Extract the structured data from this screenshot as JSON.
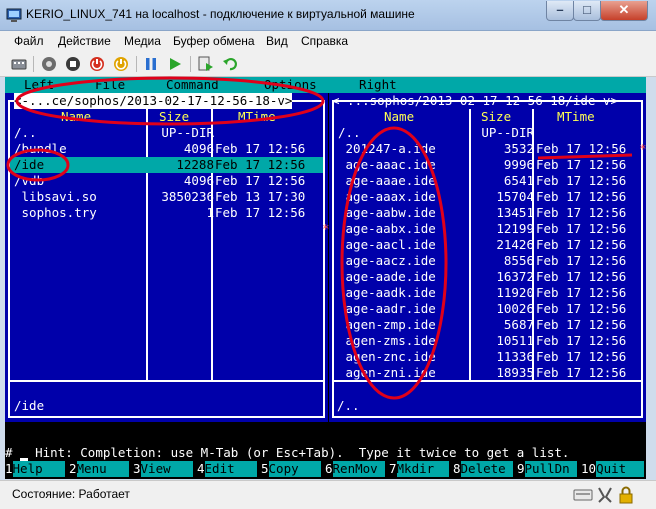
{
  "window": {
    "title": "KERIO_LINUX_741 на localhost - подключение к виртуальной машине",
    "min_label": "–",
    "max_label": "□",
    "close_label": "✕"
  },
  "menu": [
    "Файл",
    "Действие",
    "Медиа",
    "Буфер обмена",
    "Вид",
    "Справка"
  ],
  "toolbar_icons": [
    "ctrl-alt-del-icon",
    "start-icon",
    "stop-icon",
    "shutdown-icon",
    "power-icon",
    "pause-icon",
    "resume-icon",
    "snapshot-icon",
    "revert-icon"
  ],
  "mc": {
    "top_menu": [
      "Left",
      "File",
      "Command",
      "Options",
      "Right"
    ],
    "left": {
      "path": "<-...ce/sophos/2013-02-17-12-56-18-v>",
      "headers": {
        "name": "Name",
        "size": "Size",
        "mtime": "MTime"
      },
      "rows": [
        {
          "name": "/..",
          "size": "UP--DIR",
          "mtime": ""
        },
        {
          "name": "/bundle",
          "size": "4096",
          "mtime": "Feb 17 12:56"
        },
        {
          "name": "/ide",
          "size": "12288",
          "mtime": "Feb 17 12:56"
        },
        {
          "name": "/vdb",
          "size": "4096",
          "mtime": "Feb 17 12:56"
        },
        {
          "name": " libsavi.so",
          "size": "3850236",
          "mtime": "Feb 13 17:30"
        },
        {
          "name": " sophos.try",
          "size": "1",
          "mtime": "Feb 17 12:56"
        }
      ],
      "selected_index": 2,
      "mini": "/ide",
      "star": "*"
    },
    "right": {
      "path": "<-...sophos/2013-02-17-12-56-18/ide-v>",
      "headers": {
        "name": "Name",
        "size": "Size",
        "mtime": "MTime"
      },
      "rows": [
        {
          "name": "/..",
          "size": "UP--DIR",
          "mtime": ""
        },
        {
          "name": " 201247-a.ide",
          "size": "3532",
          "mtime": "Feb 17 12:56"
        },
        {
          "name": " age-aaac.ide",
          "size": "9996",
          "mtime": "Feb 17 12:56"
        },
        {
          "name": " age-aaae.ide",
          "size": "6541",
          "mtime": "Feb 17 12:56"
        },
        {
          "name": " age-aaax.ide",
          "size": "15704",
          "mtime": "Feb 17 12:56"
        },
        {
          "name": " age-aabw.ide",
          "size": "13451",
          "mtime": "Feb 17 12:56"
        },
        {
          "name": " age-aabx.ide",
          "size": "12199",
          "mtime": "Feb 17 12:56"
        },
        {
          "name": " age-aacl.ide",
          "size": "21426",
          "mtime": "Feb 17 12:56"
        },
        {
          "name": " age-aacz.ide",
          "size": "8556",
          "mtime": "Feb 17 12:56"
        },
        {
          "name": " age-aade.ide",
          "size": "16372",
          "mtime": "Feb 17 12:56"
        },
        {
          "name": " age-aadk.ide",
          "size": "11920",
          "mtime": "Feb 17 12:56"
        },
        {
          "name": " age-aadr.ide",
          "size": "10026",
          "mtime": "Feb 17 12:56"
        },
        {
          "name": " agen-zmp.ide",
          "size": "5687",
          "mtime": "Feb 17 12:56"
        },
        {
          "name": " agen-zms.ide",
          "size": "10511",
          "mtime": "Feb 17 12:56"
        },
        {
          "name": " agen-znc.ide",
          "size": "11336",
          "mtime": "Feb 17 12:56"
        },
        {
          "name": " agen-zni.ide",
          "size": "18935",
          "mtime": "Feb 17 12:56"
        }
      ],
      "mini": "/..",
      "star": "*"
    },
    "hint": "Hint: Completion: use M-Tab (or Esc+Tab).  Type it twice to get a list.",
    "hint_tag": "[^]",
    "prompt": "# ",
    "fkeys": [
      {
        "n": "1",
        "label": "Help"
      },
      {
        "n": "2",
        "label": "Menu"
      },
      {
        "n": "3",
        "label": "View"
      },
      {
        "n": "4",
        "label": "Edit"
      },
      {
        "n": "5",
        "label": "Copy"
      },
      {
        "n": "6",
        "label": "RenMov"
      },
      {
        "n": "7",
        "label": "Mkdir"
      },
      {
        "n": "8",
        "label": "Delete"
      },
      {
        "n": "9",
        "label": "PullDn"
      },
      {
        "n": "10",
        "label": "Quit"
      }
    ]
  },
  "status": {
    "text": "Состояние: Работает"
  },
  "colors": {
    "panel": "#0000aa",
    "cyan": "#00a8a8",
    "header": "#ffff54",
    "annotation": "#e0001a"
  }
}
